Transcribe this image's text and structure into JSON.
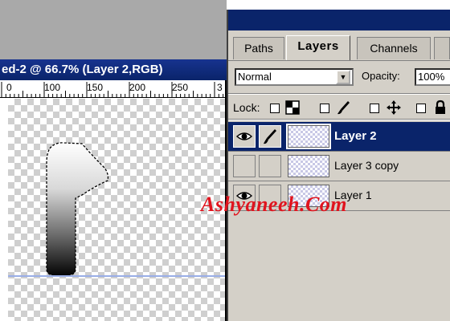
{
  "document": {
    "title": "ed-2 @ 66.7% (Layer 2,RGB)",
    "ruler_labels": [
      "0",
      "100",
      "150",
      "200",
      "250",
      "3"
    ]
  },
  "palette": {
    "tabs": [
      {
        "label": "Paths",
        "active": false
      },
      {
        "label": "Layers",
        "active": true
      },
      {
        "label": "Channels",
        "active": false
      }
    ],
    "blend_mode": "Normal",
    "opacity_label": "Opacity:",
    "opacity_value": "100%",
    "lock_label": "Lock:",
    "lock_icons": [
      "transparency-lock-icon",
      "brush-lock-icon",
      "move-lock-icon",
      "padlock-icon"
    ],
    "layers": [
      {
        "name": "Layer 2",
        "selected": true,
        "visible": true,
        "linked_brush": true
      },
      {
        "name": "Layer 3 copy",
        "selected": false,
        "visible": false,
        "linked_brush": false
      },
      {
        "name": "Layer 1",
        "selected": false,
        "visible": true,
        "linked_brush": false
      }
    ]
  },
  "watermark": "Ashyaneeh.Com",
  "colors": {
    "title_bar": "#0a246a",
    "panel_bg": "#d4d0c8",
    "watermark": "#e0141e",
    "guide_line": "#9aaee6"
  }
}
